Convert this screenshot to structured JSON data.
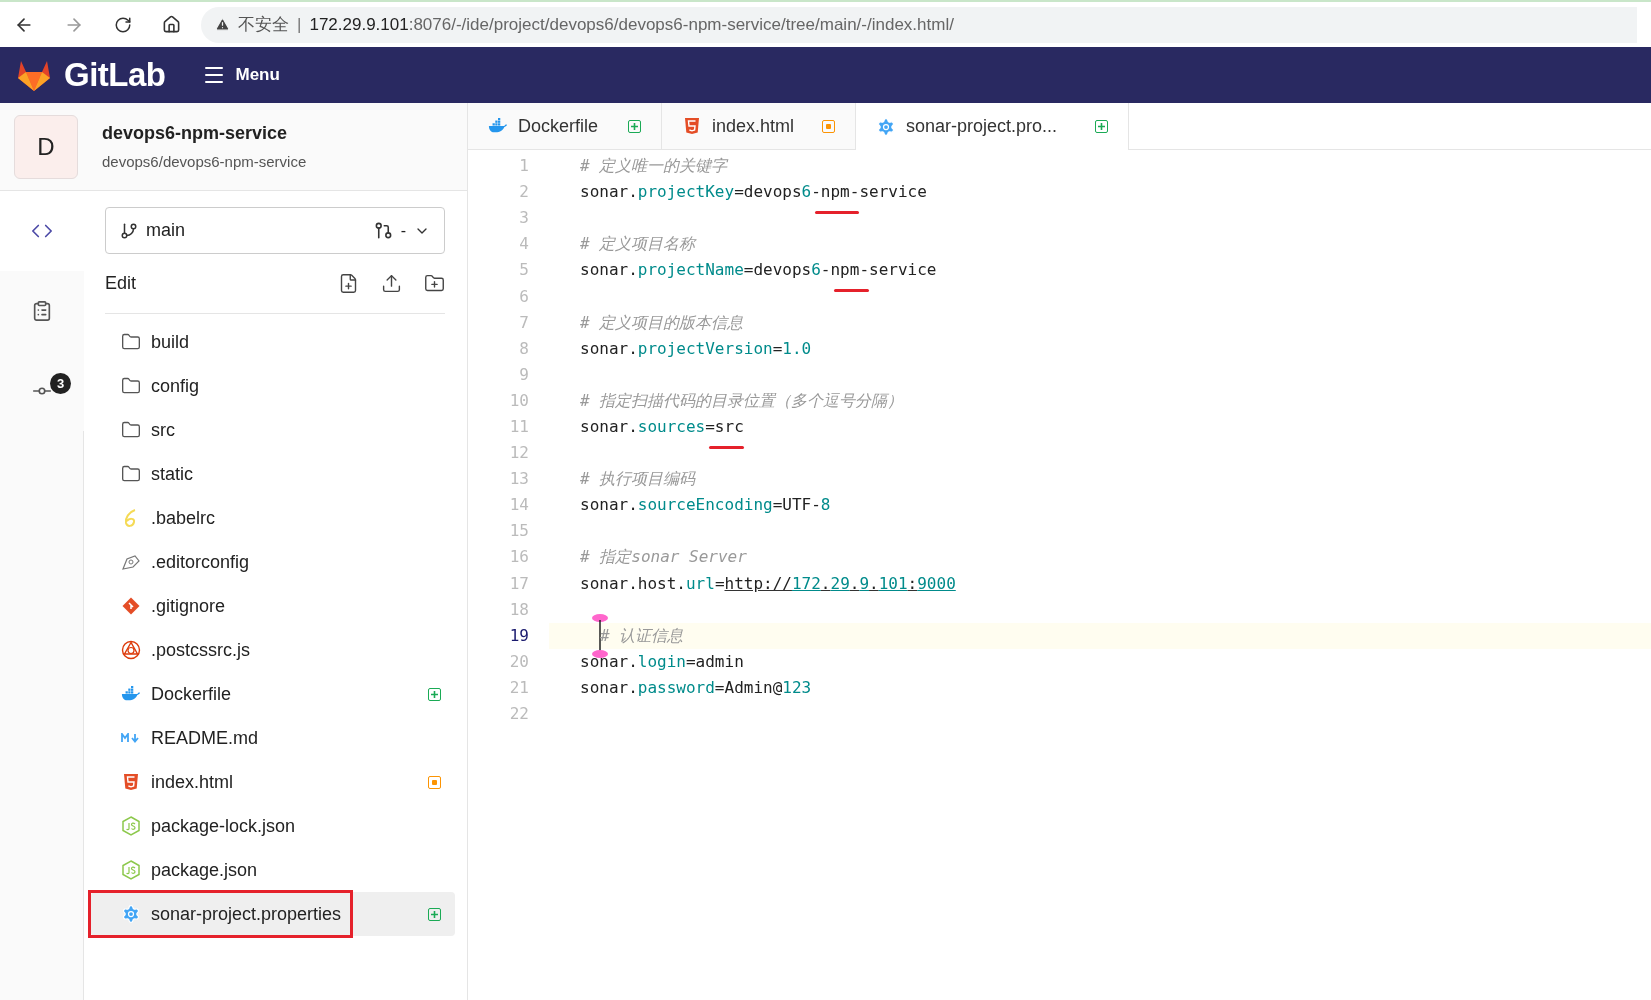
{
  "browser": {
    "security": "不安全",
    "separator": "|",
    "url_host": "172.29.9.101",
    "url_path": ":8076/-/ide/project/devops6/devops6-npm-service/tree/main/-/index.html/"
  },
  "header": {
    "logo": "GitLab",
    "menu": "Menu"
  },
  "project": {
    "avatar": "D",
    "name": "devops6-npm-service",
    "path": "devops6/devops6-npm-service"
  },
  "rail": [
    {
      "kind": "code",
      "selected": true
    },
    {
      "kind": "clipboard",
      "selected": false
    },
    {
      "kind": "commit",
      "selected": false,
      "badge": "3"
    }
  ],
  "branch": {
    "name": "main",
    "merge_request": "-"
  },
  "tree_header": "Edit",
  "files": [
    {
      "name": "build",
      "kind": "folder",
      "added": false,
      "modified": false,
      "selected": false,
      "annotated": false
    },
    {
      "name": "config",
      "kind": "folder",
      "added": false,
      "modified": false,
      "selected": false,
      "annotated": false
    },
    {
      "name": "src",
      "kind": "folder",
      "added": false,
      "modified": false,
      "selected": false,
      "annotated": false
    },
    {
      "name": "static",
      "kind": "folder",
      "added": false,
      "modified": false,
      "selected": false,
      "annotated": false
    },
    {
      "name": ".babelrc",
      "kind": "babel",
      "added": false,
      "modified": false,
      "selected": false,
      "annotated": false
    },
    {
      "name": ".editorconfig",
      "kind": "editorconfig",
      "added": false,
      "modified": false,
      "selected": false,
      "annotated": false
    },
    {
      "name": ".gitignore",
      "kind": "git",
      "added": false,
      "modified": false,
      "selected": false,
      "annotated": false
    },
    {
      "name": ".postcssrc.js",
      "kind": "postcss",
      "added": false,
      "modified": false,
      "selected": false,
      "annotated": false
    },
    {
      "name": "Dockerfile",
      "kind": "docker",
      "added": true,
      "modified": false,
      "selected": false,
      "annotated": false
    },
    {
      "name": "README.md",
      "kind": "markdown",
      "added": false,
      "modified": false,
      "selected": false,
      "annotated": false
    },
    {
      "name": "index.html",
      "kind": "html",
      "added": false,
      "modified": true,
      "selected": false,
      "annotated": false
    },
    {
      "name": "package-lock.json",
      "kind": "node",
      "added": false,
      "modified": false,
      "selected": false,
      "annotated": false
    },
    {
      "name": "package.json",
      "kind": "node",
      "added": false,
      "modified": false,
      "selected": false,
      "annotated": false
    },
    {
      "name": "sonar-project.properties",
      "kind": "gear",
      "added": true,
      "modified": false,
      "selected": true,
      "annotated": true
    }
  ],
  "tabs": [
    {
      "label": "Dockerfile",
      "kind": "docker",
      "added": true,
      "modified": false,
      "selected": false
    },
    {
      "label": "index.html",
      "kind": "html",
      "added": false,
      "modified": true,
      "selected": false
    },
    {
      "label": "sonar-project.pro...",
      "kind": "gear",
      "added": true,
      "modified": false,
      "selected": true
    }
  ],
  "code": [
    {
      "number": "1",
      "current": false,
      "tokens": [
        {
          "text": "# 定义唯一的关键字",
          "kind": "comment",
          "marked": false
        }
      ]
    },
    {
      "number": "2",
      "current": false,
      "tokens": [
        {
          "text": "sonar.",
          "kind": "plain",
          "marked": false
        },
        {
          "text": "projectKey",
          "kind": "key",
          "marked": false
        },
        {
          "text": "=devops",
          "kind": "plain",
          "marked": false
        },
        {
          "text": "6",
          "kind": "number",
          "marked": false
        },
        {
          "text": "-npm-",
          "kind": "plain",
          "marked": true
        },
        {
          "text": "service",
          "kind": "plain",
          "marked": false
        }
      ]
    },
    {
      "number": "3",
      "current": false
    },
    {
      "number": "4",
      "current": false,
      "tokens": [
        {
          "text": "# 定义项目名称",
          "kind": "comment",
          "marked": false
        }
      ]
    },
    {
      "number": "5",
      "current": false,
      "tokens": [
        {
          "text": "sonar.",
          "kind": "plain",
          "marked": false
        },
        {
          "text": "projectName",
          "kind": "key",
          "marked": false
        },
        {
          "text": "=devops",
          "kind": "plain",
          "marked": false
        },
        {
          "text": "6",
          "kind": "number",
          "marked": false
        },
        {
          "text": "-",
          "kind": "plain",
          "marked": false
        },
        {
          "text": "npm-",
          "kind": "plain",
          "marked": true
        },
        {
          "text": "service",
          "kind": "plain",
          "marked": false
        }
      ]
    },
    {
      "number": "6",
      "current": false
    },
    {
      "number": "7",
      "current": false,
      "tokens": [
        {
          "text": "# 定义项目的版本信息",
          "kind": "comment",
          "marked": false
        }
      ]
    },
    {
      "number": "8",
      "current": false,
      "tokens": [
        {
          "text": "sonar.",
          "kind": "plain",
          "marked": false
        },
        {
          "text": "projectVersion",
          "kind": "key",
          "marked": false
        },
        {
          "text": "=",
          "kind": "plain",
          "marked": false
        },
        {
          "text": "1.0",
          "kind": "number",
          "marked": false
        }
      ]
    },
    {
      "number": "9",
      "current": false
    },
    {
      "number": "10",
      "current": false,
      "tokens": [
        {
          "text": "# 指定扫描代码的目录位置（多个逗号分隔）",
          "kind": "comment",
          "marked": false
        }
      ]
    },
    {
      "number": "11",
      "current": false,
      "tokens": [
        {
          "text": "sonar.",
          "kind": "plain",
          "marked": false
        },
        {
          "text": "sources",
          "kind": "key",
          "marked": false
        },
        {
          "text": "=src",
          "kind": "plain",
          "marked": true
        }
      ]
    },
    {
      "number": "12",
      "current": false
    },
    {
      "number": "13",
      "current": false,
      "tokens": [
        {
          "text": "# 执行项目编码",
          "kind": "comment",
          "marked": false
        }
      ]
    },
    {
      "number": "14",
      "current": false,
      "tokens": [
        {
          "text": "sonar.",
          "kind": "plain",
          "marked": false
        },
        {
          "text": "sourceEncoding",
          "kind": "key",
          "marked": false
        },
        {
          "text": "=UTF-",
          "kind": "plain",
          "marked": false
        },
        {
          "text": "8",
          "kind": "number",
          "marked": false
        }
      ]
    },
    {
      "number": "15",
      "current": false
    },
    {
      "number": "16",
      "current": false,
      "tokens": [
        {
          "text": "# 指定sonar Server",
          "kind": "comment",
          "marked": false
        }
      ]
    },
    {
      "number": "17",
      "current": false,
      "tokens": [
        {
          "text": "sonar.host.",
          "kind": "plain",
          "marked": false
        },
        {
          "text": "url",
          "kind": "key",
          "marked": false
        },
        {
          "text": "=",
          "kind": "plain",
          "marked": false
        },
        {
          "text": "http://",
          "kind": "link",
          "marked": false
        },
        {
          "text": "172",
          "kind": "link_number",
          "marked": false
        },
        {
          "text": ".",
          "kind": "link",
          "marked": false
        },
        {
          "text": "29",
          "kind": "link_number",
          "marked": false
        },
        {
          "text": ".",
          "kind": "link",
          "marked": false
        },
        {
          "text": "9",
          "kind": "link_number",
          "marked": false
        },
        {
          "text": ".",
          "kind": "link",
          "marked": false
        },
        {
          "text": "101",
          "kind": "link_number",
          "marked": false
        },
        {
          "text": ":",
          "kind": "link",
          "marked": false
        },
        {
          "text": "9000",
          "kind": "link_number",
          "marked": false
        }
      ]
    },
    {
      "number": "18",
      "current": false
    },
    {
      "number": "19",
      "current": true,
      "tokens": [
        {
          "text": "# 认证信息",
          "kind": "comment",
          "marked": false
        }
      ]
    },
    {
      "number": "20",
      "current": false,
      "tokens": [
        {
          "text": "sonar.",
          "kind": "plain",
          "marked": false
        },
        {
          "text": "login",
          "kind": "key",
          "marked": false
        },
        {
          "text": "=admin",
          "kind": "plain",
          "marked": false
        }
      ]
    },
    {
      "number": "21",
      "current": false,
      "tokens": [
        {
          "text": "sonar.",
          "kind": "plain",
          "marked": false
        },
        {
          "text": "password",
          "kind": "key",
          "marked": false
        },
        {
          "text": "=Admin@",
          "kind": "plain",
          "marked": false
        },
        {
          "text": "123",
          "kind": "number",
          "marked": false
        }
      ]
    },
    {
      "number": "22",
      "current": false
    }
  ]
}
